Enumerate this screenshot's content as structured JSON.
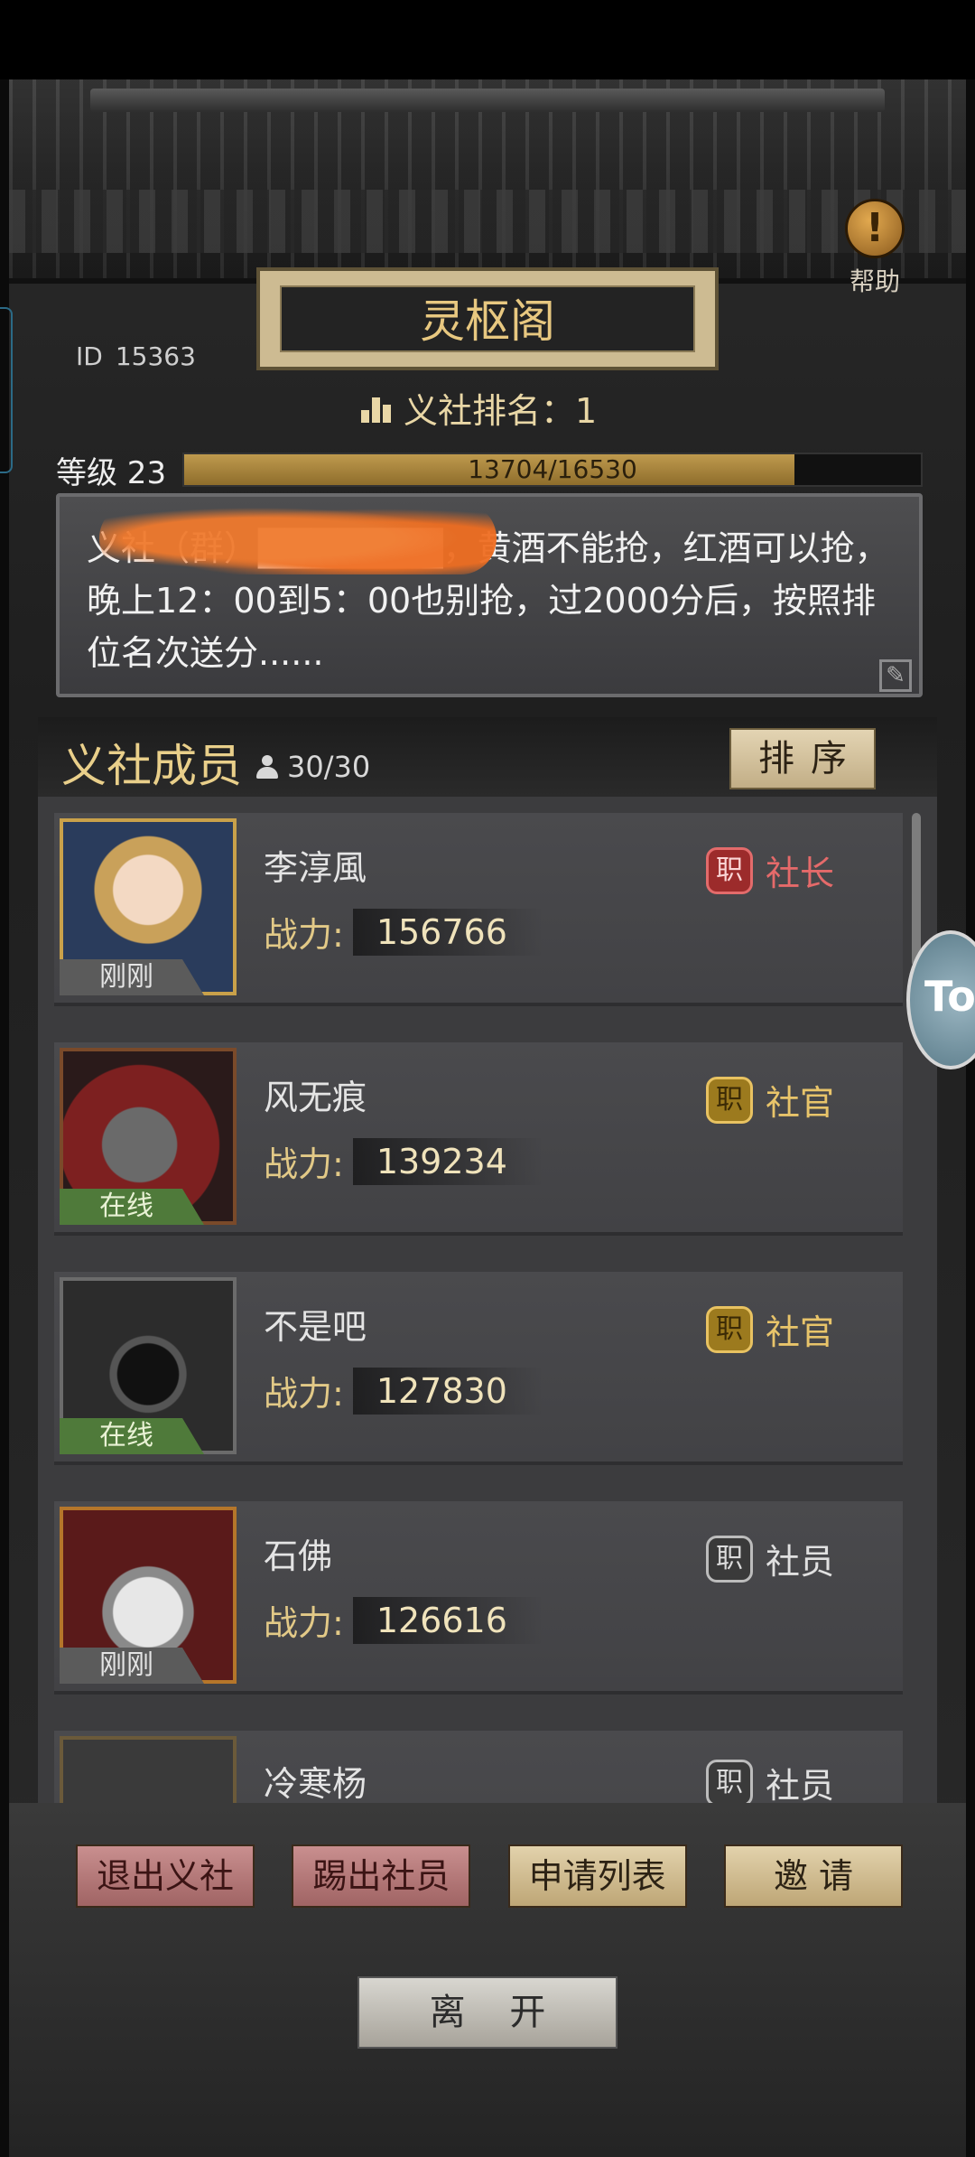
{
  "header": {
    "guild_name": "灵枢阁",
    "help_label": "帮助",
    "id_label": "ID",
    "id_value": "15363",
    "rank_label": "义社排名：1",
    "level_label": "等级 23",
    "level_progress_text": "13704/16530",
    "level_progress_fraction": 0.829
  },
  "notice": {
    "text": "义社（群）███████，黄酒不能抢，红酒可以抢，晚上12：00到5：00也别抢，过2000分后，按照排位名次送分......"
  },
  "members": {
    "title": "义社成员",
    "count": "30/30",
    "sort_label": "排序",
    "rows": [
      {
        "status": "刚刚",
        "name": "李淳風",
        "power_label": "战力:",
        "power": "156766",
        "role_icon": "职",
        "role": "社长"
      },
      {
        "status": "在线",
        "name": "风无痕",
        "power_label": "战力:",
        "power": "139234",
        "role_icon": "职",
        "role": "社官"
      },
      {
        "status": "在线",
        "name": "不是吧",
        "power_label": "战力:",
        "power": "127830",
        "role_icon": "职",
        "role": "社官"
      },
      {
        "status": "刚刚",
        "name": "石佛",
        "power_label": "战力:",
        "power": "126616",
        "role_icon": "职",
        "role": "社员"
      },
      {
        "status": "",
        "name": "冷寒杨",
        "power_label": "",
        "power": "",
        "role_icon": "职",
        "role": "社员"
      }
    ]
  },
  "actions": {
    "quit": "退出义社",
    "kick": "踢出社员",
    "applications": "申请列表",
    "invite": "邀 请"
  },
  "leave_label": "离 开",
  "side_badge_text": "To",
  "colors": {
    "gold_text": "#e9cf8a",
    "leader_red": "#e56a6a",
    "officer_gold": "#e8c46a",
    "online_green": "#4f7a3a"
  }
}
